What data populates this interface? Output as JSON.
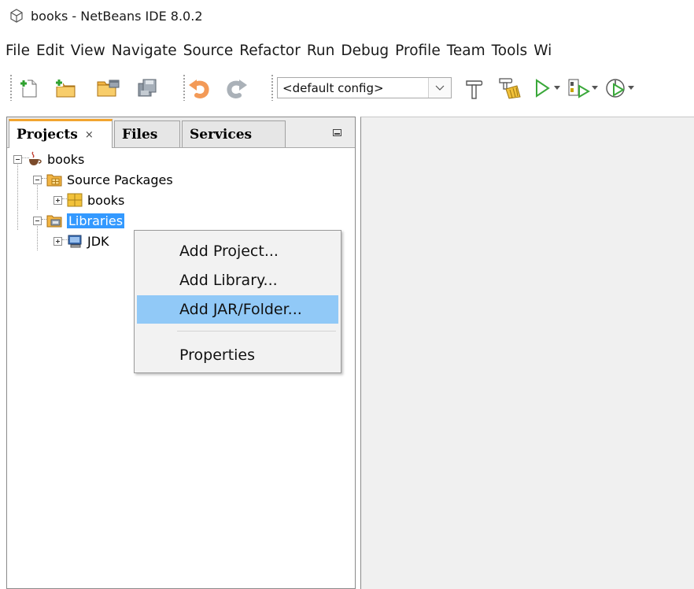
{
  "window": {
    "title": "books - NetBeans IDE 8.0.2"
  },
  "menubar": [
    "File",
    "Edit",
    "View",
    "Navigate",
    "Source",
    "Refactor",
    "Run",
    "Debug",
    "Profile",
    "Team",
    "Tools",
    "Wi"
  ],
  "toolbar": {
    "config_value": "<default config>",
    "icons": [
      "new-file-icon",
      "new-project-icon",
      "open-project-icon",
      "save-all-icon",
      "undo-icon",
      "redo-icon",
      "build-icon",
      "clean-build-icon",
      "run-icon",
      "debug-icon",
      "profile-icon"
    ]
  },
  "panel": {
    "tabs": [
      {
        "label": "Projects",
        "close": "×",
        "active": true
      },
      {
        "label": "Files",
        "active": false
      },
      {
        "label": "Services",
        "active": false
      }
    ]
  },
  "tree": [
    {
      "label": "books",
      "icon": "java-project-icon",
      "expanded": true,
      "depth": 0
    },
    {
      "label": "Source Packages",
      "icon": "source-packages-icon",
      "expanded": true,
      "depth": 1
    },
    {
      "label": "books",
      "icon": "package-icon",
      "expanded": false,
      "depth": 2
    },
    {
      "label": "Libraries",
      "icon": "libraries-icon",
      "expanded": true,
      "depth": 1,
      "selected": true
    },
    {
      "label": "JDK",
      "icon": "jdk-icon",
      "expanded": false,
      "depth": 2
    }
  ],
  "context_menu": {
    "items": [
      "Add Project...",
      "Add Library...",
      "Add JAR/Folder...",
      "Properties"
    ],
    "highlighted": "Add JAR/Folder..."
  },
  "colors": {
    "selection": "#3399ff",
    "menu_highlight": "#91c9f7",
    "active_tab_accent": "#f2a530"
  }
}
